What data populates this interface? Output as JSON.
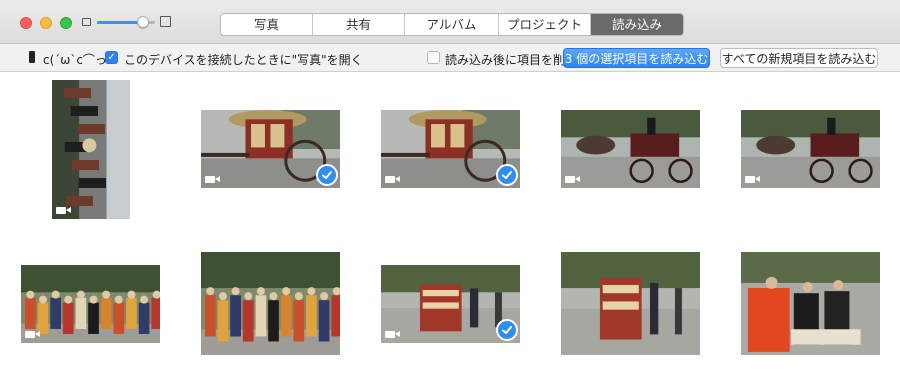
{
  "window": {
    "tabs": [
      {
        "label": "写真"
      },
      {
        "label": "共有"
      },
      {
        "label": "アルバム"
      },
      {
        "label": "プロジェクト"
      },
      {
        "label": "読み込み"
      }
    ],
    "active_tab_index": 4,
    "zoom_level": 0.8
  },
  "toolbar": {
    "device_name": "c(´ω`c⌒っ",
    "open_photos_label": "このデバイスを接続したときに\"写真\"を開く",
    "open_photos_checked": true,
    "delete_after_import_label": "読み込み後に項目を削除",
    "delete_after_import_checked": false,
    "import_selected_label": "3 個の選択項目を読み込む",
    "import_all_new_label": "すべての新規項目を読み込む"
  },
  "items": [
    {
      "kind": "video",
      "selected": false,
      "subject": "portrait-procession"
    },
    {
      "kind": "video",
      "selected": true,
      "subject": "ox-cart"
    },
    {
      "kind": "video",
      "selected": true,
      "subject": "ox-cart"
    },
    {
      "kind": "video",
      "selected": false,
      "subject": "horse-carriage"
    },
    {
      "kind": "video",
      "selected": false,
      "subject": "horse-carriage"
    },
    {
      "kind": "video",
      "selected": false,
      "subject": "procession-crowd"
    },
    {
      "kind": "photo",
      "selected": false,
      "subject": "procession-crowd"
    },
    {
      "kind": "video",
      "selected": true,
      "subject": "warrior-walking"
    },
    {
      "kind": "photo",
      "selected": false,
      "subject": "warrior-walking"
    },
    {
      "kind": "photo",
      "selected": false,
      "subject": "red-robes"
    }
  ],
  "colors": {
    "accent": "#2f8ef5",
    "active_tab": "#6a6a6a"
  }
}
